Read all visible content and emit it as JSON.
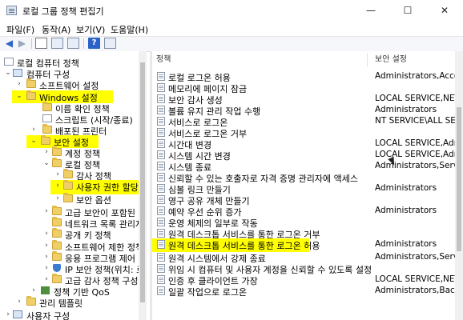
{
  "window": {
    "title": "로컬 그룹 정책 편집기",
    "minimize": "—",
    "maximize": "☐",
    "close": "✕"
  },
  "menu": [
    "파일(F)",
    "동작(A)",
    "보기(V)",
    "도움말(H)"
  ],
  "toolbar": {
    "back": "◀",
    "forward": "▶"
  },
  "tree": {
    "items": [
      {
        "label": "로컬 컴퓨터 정책",
        "highlight": false,
        "expanded": true,
        "icon": "document-icon"
      },
      {
        "label": "컴퓨터 구성",
        "highlight": false,
        "expanded": true,
        "icon": "computer-icon"
      },
      {
        "label": "소프트웨어 설정",
        "highlight": false,
        "expanded": false,
        "icon": "folder-icon"
      },
      {
        "label": "Windows 설정",
        "highlight": true,
        "expanded": true,
        "icon": "folder-icon"
      },
      {
        "label": "이름 확인 정책",
        "highlight": false,
        "expanded": false,
        "icon": "folder-icon"
      },
      {
        "label": "스크립트 (시작/종료)",
        "highlight": false,
        "expanded": false,
        "icon": "document-icon"
      },
      {
        "label": "배포된 프린터",
        "highlight": false,
        "expanded": false,
        "icon": "folder-icon"
      },
      {
        "label": "보안 설정",
        "highlight": true,
        "expanded": true,
        "icon": "folder-icon"
      },
      {
        "label": "계정 정책",
        "highlight": false,
        "expanded": false,
        "icon": "folder-icon"
      },
      {
        "label": "로컬 정책",
        "highlight": false,
        "expanded": true,
        "icon": "folder-icon"
      },
      {
        "label": "감사 정책",
        "highlight": false,
        "expanded": false,
        "icon": "folder-icon"
      },
      {
        "label": "사용자 권한 할당",
        "highlight": true,
        "expanded": false,
        "icon": "folder-icon"
      },
      {
        "label": "보안 옵션",
        "highlight": false,
        "expanded": false,
        "icon": "folder-icon"
      },
      {
        "label": "고급 보안이 포함된 Wi",
        "highlight": false,
        "expanded": false,
        "icon": "folder-icon"
      },
      {
        "label": "네트워크 목록 관리자 정",
        "highlight": false,
        "expanded": false,
        "icon": "folder-icon"
      },
      {
        "label": "공개 키 정책",
        "highlight": false,
        "expanded": false,
        "icon": "folder-icon"
      },
      {
        "label": "소프트웨어 제한 정책",
        "highlight": false,
        "expanded": false,
        "icon": "folder-icon"
      },
      {
        "label": "응용 프로그램 제어 정",
        "highlight": false,
        "expanded": false,
        "icon": "folder-icon"
      },
      {
        "label": "IP 보안 정책(위치: 로",
        "highlight": false,
        "expanded": false,
        "icon": "shield-icon"
      },
      {
        "label": "고급 감사 정책 구성",
        "highlight": false,
        "expanded": false,
        "icon": "folder-icon"
      },
      {
        "label": "정책 기반 QoS",
        "highlight": false,
        "expanded": false,
        "icon": "chart-icon"
      },
      {
        "label": "관리 템플릿",
        "highlight": false,
        "expanded": false,
        "icon": "folder-icon"
      },
      {
        "label": "사용자 구성",
        "highlight": false,
        "expanded": false,
        "icon": "computer-icon"
      }
    ]
  },
  "list": {
    "columns": [
      "정책",
      "보안 설정"
    ],
    "rows": [
      {
        "policy": "로컬 로그온 허용",
        "setting": "Administrators,Account...",
        "highlight": false
      },
      {
        "policy": "메모리에 페이지 잠금",
        "setting": "",
        "highlight": false
      },
      {
        "policy": "보안 감사 생성",
        "setting": "LOCAL SERVICE,NETW...",
        "highlight": false
      },
      {
        "policy": "볼륨 유지 관리 작업 수행",
        "setting": "Administrators",
        "highlight": false
      },
      {
        "policy": "서비스로 로그온",
        "setting": "NT SERVICE\\ALL SERVICE",
        "highlight": false
      },
      {
        "policy": "서비스로 로그온 거부",
        "setting": "",
        "highlight": false
      },
      {
        "policy": "시간대 변경",
        "setting": "LOCAL SERVICE,Admini...",
        "highlight": false
      },
      {
        "policy": "시스템 시간 변경",
        "setting": "LOCAL SERVICE,Admini...",
        "highlight": false
      },
      {
        "policy": "시스템 종료",
        "setting": "Administrators,Server O...",
        "highlight": false
      },
      {
        "policy": "신뢰할 수 있는 호출자로 자격 증명 관리자에 액세스",
        "setting": "",
        "highlight": false
      },
      {
        "policy": "심볼 링크 만들기",
        "setting": "Administrators",
        "highlight": false
      },
      {
        "policy": "영구 공유 개체 만들기",
        "setting": "",
        "highlight": false
      },
      {
        "policy": "예약 우선 순위 증가",
        "setting": "Administrators",
        "highlight": false
      },
      {
        "policy": "운영 체제의 일부로 작동",
        "setting": "",
        "highlight": false
      },
      {
        "policy": "원격 데스크톱 서비스를 통한 로그온 거부",
        "setting": "",
        "highlight": false
      },
      {
        "policy": "원격 데스크톱 서비스를 통한 로그온 허용",
        "setting": "Administrators",
        "highlight": true
      },
      {
        "policy": "원격 시스템에서 강제 종료",
        "setting": "Administrators,Server O...",
        "highlight": false
      },
      {
        "policy": "위임 시 컴퓨터 및 사용자 계정을 신뢰할 수 있도록 설정",
        "setting": "",
        "highlight": false
      },
      {
        "policy": "인증 후 클라이언트 가장",
        "setting": "LOCAL SERVICE,NETW...",
        "highlight": false
      },
      {
        "policy": "일괄 작업으로 로그온",
        "setting": "Administrators,Backup ...",
        "highlight": false
      }
    ]
  }
}
